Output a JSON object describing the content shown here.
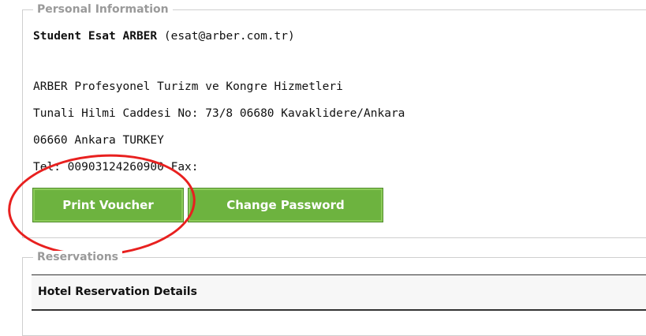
{
  "personal": {
    "legend": "Personal Information",
    "student_prefix": "Student Esat ARBER",
    "email": " (esat@arber.com.tr)",
    "company": "ARBER Profesyonel Turizm ve Kongre Hizmetleri",
    "address_line1": "Tunali Hilmi Caddesi No: 73/8 06680 Kavaklidere/Ankara",
    "address_line2": "06660 Ankara TURKEY",
    "phone": "Tel: 00903124260900 Fax:"
  },
  "buttons": {
    "print_voucher": "Print Voucher",
    "change_password": "Change Password"
  },
  "reservations": {
    "legend": "Reservations",
    "table_header": "Hotel Reservation Details"
  },
  "colors": {
    "button_bg": "#6db33f",
    "annotation": "#e8201f"
  }
}
